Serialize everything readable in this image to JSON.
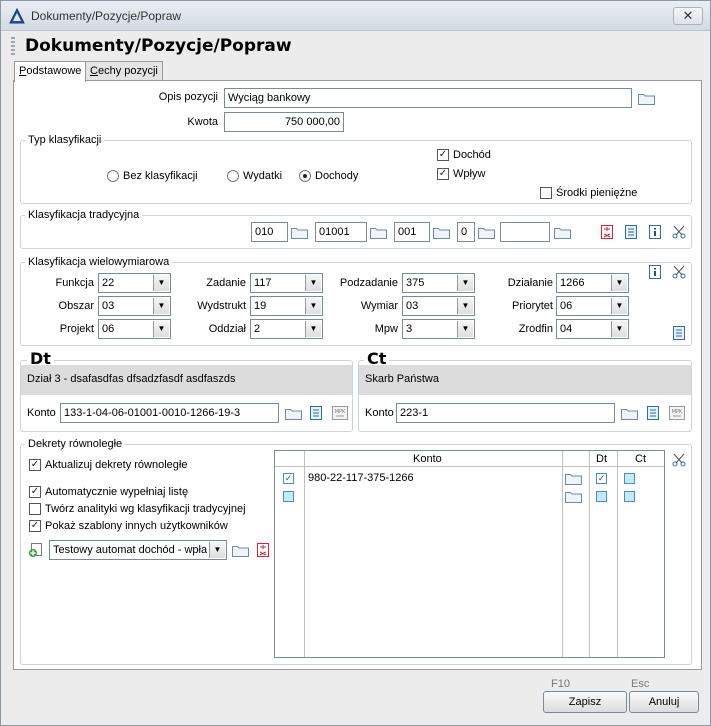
{
  "window": {
    "title": "Dokumenty/Pozycje/Popraw",
    "close_label": "✕"
  },
  "header": {
    "title": "Dokumenty/Pozycje/Popraw"
  },
  "tabs": [
    {
      "label_underlined": "P",
      "label_rest": "odstawowe"
    },
    {
      "label_underlined": "C",
      "label_rest": "echy pozycji"
    }
  ],
  "basic": {
    "opis_label": "Opis pozycji",
    "opis_value": "Wyciąg bankowy",
    "kwota_label": "Kwota",
    "kwota_value": "750 000,00"
  },
  "typ_klasyfikacji": {
    "title": "Typ klasyfikacji",
    "radios": [
      "Bez klasyfikacji",
      "Wydatki",
      "Dochody"
    ],
    "checks": [
      "Dochód",
      "Wpływ",
      "Środki pieniężne"
    ]
  },
  "tradycyjna": {
    "title": "Klasyfikacja tradycyjna",
    "fields": [
      "010",
      "01001",
      "001",
      "0",
      ""
    ]
  },
  "wielowymiarowa": {
    "title": "Klasyfikacja wielowymiarowa",
    "rows": [
      [
        {
          "label": "Funkcja",
          "value": "22"
        },
        {
          "label": "Zadanie",
          "value": "117"
        },
        {
          "label": "Podzadanie",
          "value": "375"
        },
        {
          "label": "Działanie",
          "value": "1266"
        }
      ],
      [
        {
          "label": "Obszar",
          "value": "03"
        },
        {
          "label": "Wydstrukt",
          "value": "19"
        },
        {
          "label": "Wymiar",
          "value": "03"
        },
        {
          "label": "Priorytet",
          "value": "06"
        }
      ],
      [
        {
          "label": "Projekt",
          "value": "06"
        },
        {
          "label": "Oddział",
          "value": "2"
        },
        {
          "label": "Mpw",
          "value": "3"
        },
        {
          "label": "Zrodfin",
          "value": "04"
        }
      ]
    ]
  },
  "dt": {
    "title": "Dt",
    "desc": "Dział 3 - dsafasdfas dfsadzfasdf asdfaszds",
    "konto_label": "Konto",
    "konto_value": "133-1-04-06-01001-0010-1266-19-3",
    "mpk_label": "MPK"
  },
  "ct": {
    "title": "Ct",
    "desc": "Skarb Państwa",
    "konto_label": "Konto",
    "konto_value": "223-1",
    "mpk_label": "MPK"
  },
  "dekrety": {
    "title": "Dekrety równoległe",
    "checks": [
      "Aktualizuj dekrety równoległe",
      "Automatycznie wypełniaj listę",
      "Twórz analityki wg klasyfikacji tradycyjnej",
      "Pokaż szablony innych użytkowników"
    ],
    "automat_value": "Testowy automat dochód - wpła",
    "grid": {
      "headers": [
        "Konto",
        "Dt",
        "Ct"
      ],
      "rows": [
        {
          "konto": "980-22-117-375-1266"
        },
        {
          "konto": ""
        }
      ]
    }
  },
  "footer": {
    "save_key": "F10",
    "save_label": "Zapisz",
    "cancel_key": "Esc",
    "cancel_label": "Anuluj"
  },
  "colors": {
    "checkbox_blue": "#3b93c8",
    "panel_grey": "#dcdcdc"
  }
}
